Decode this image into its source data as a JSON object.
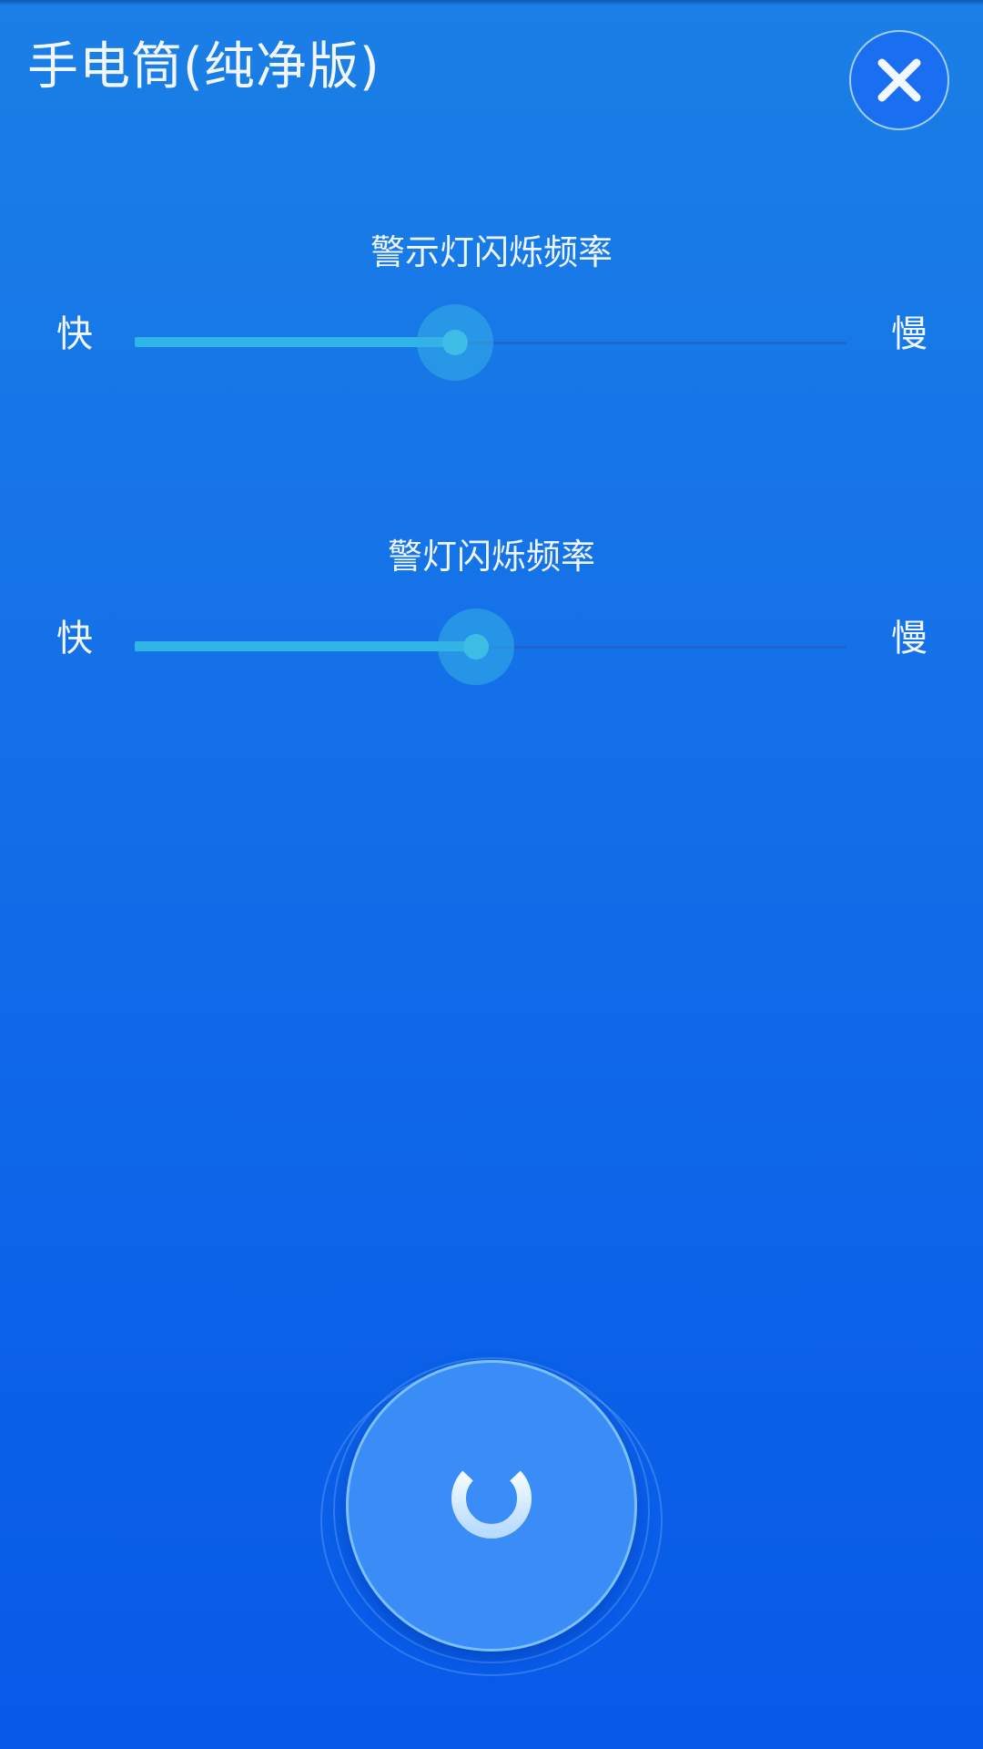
{
  "app": {
    "title": "手电筒(纯净版)"
  },
  "header": {
    "close_icon": "close-icon"
  },
  "sliders": [
    {
      "title": "警示灯闪烁频率",
      "min_label": "快",
      "max_label": "慢",
      "value_fraction": 0.45
    },
    {
      "title": "警灯闪烁频率",
      "min_label": "快",
      "max_label": "慢",
      "value_fraction": 0.48
    }
  ],
  "power": {
    "icon": "power-icon",
    "state": "off"
  },
  "colors": {
    "background_top": "#1a7fe6",
    "background_bottom": "#075ae8",
    "slider_fill": "#31b4e6",
    "power_button": "#3a8cf6"
  }
}
